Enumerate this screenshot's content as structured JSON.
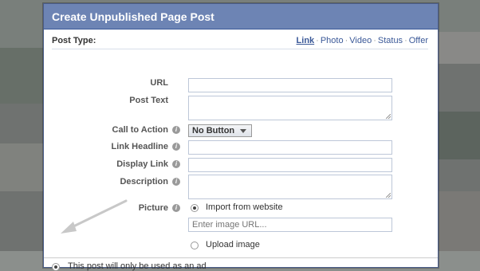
{
  "dialog": {
    "title": "Create Unpublished Page Post",
    "post_type": {
      "label": "Post Type:",
      "options": [
        "Link",
        "Photo",
        "Video",
        "Status",
        "Offer"
      ],
      "selected": "Link"
    },
    "fields": {
      "url": {
        "label": "URL",
        "value": ""
      },
      "post_text": {
        "label": "Post Text",
        "value": ""
      },
      "call_to_action": {
        "label": "Call to Action",
        "value": "No Button"
      },
      "link_headline": {
        "label": "Link Headline",
        "value": ""
      },
      "display_link": {
        "label": "Display Link",
        "value": ""
      },
      "description": {
        "label": "Description",
        "value": ""
      },
      "picture": {
        "label": "Picture",
        "import_option": "Import from website",
        "image_url_placeholder": "Enter image URL...",
        "upload_option": "Upload image",
        "selected": "import"
      }
    },
    "ad_only": {
      "label": "This post will only be used as an ad",
      "selected": true
    }
  },
  "colors": {
    "header_bg": "#6d84b4",
    "link": "#3b5998",
    "background": "#8b8f8c"
  }
}
